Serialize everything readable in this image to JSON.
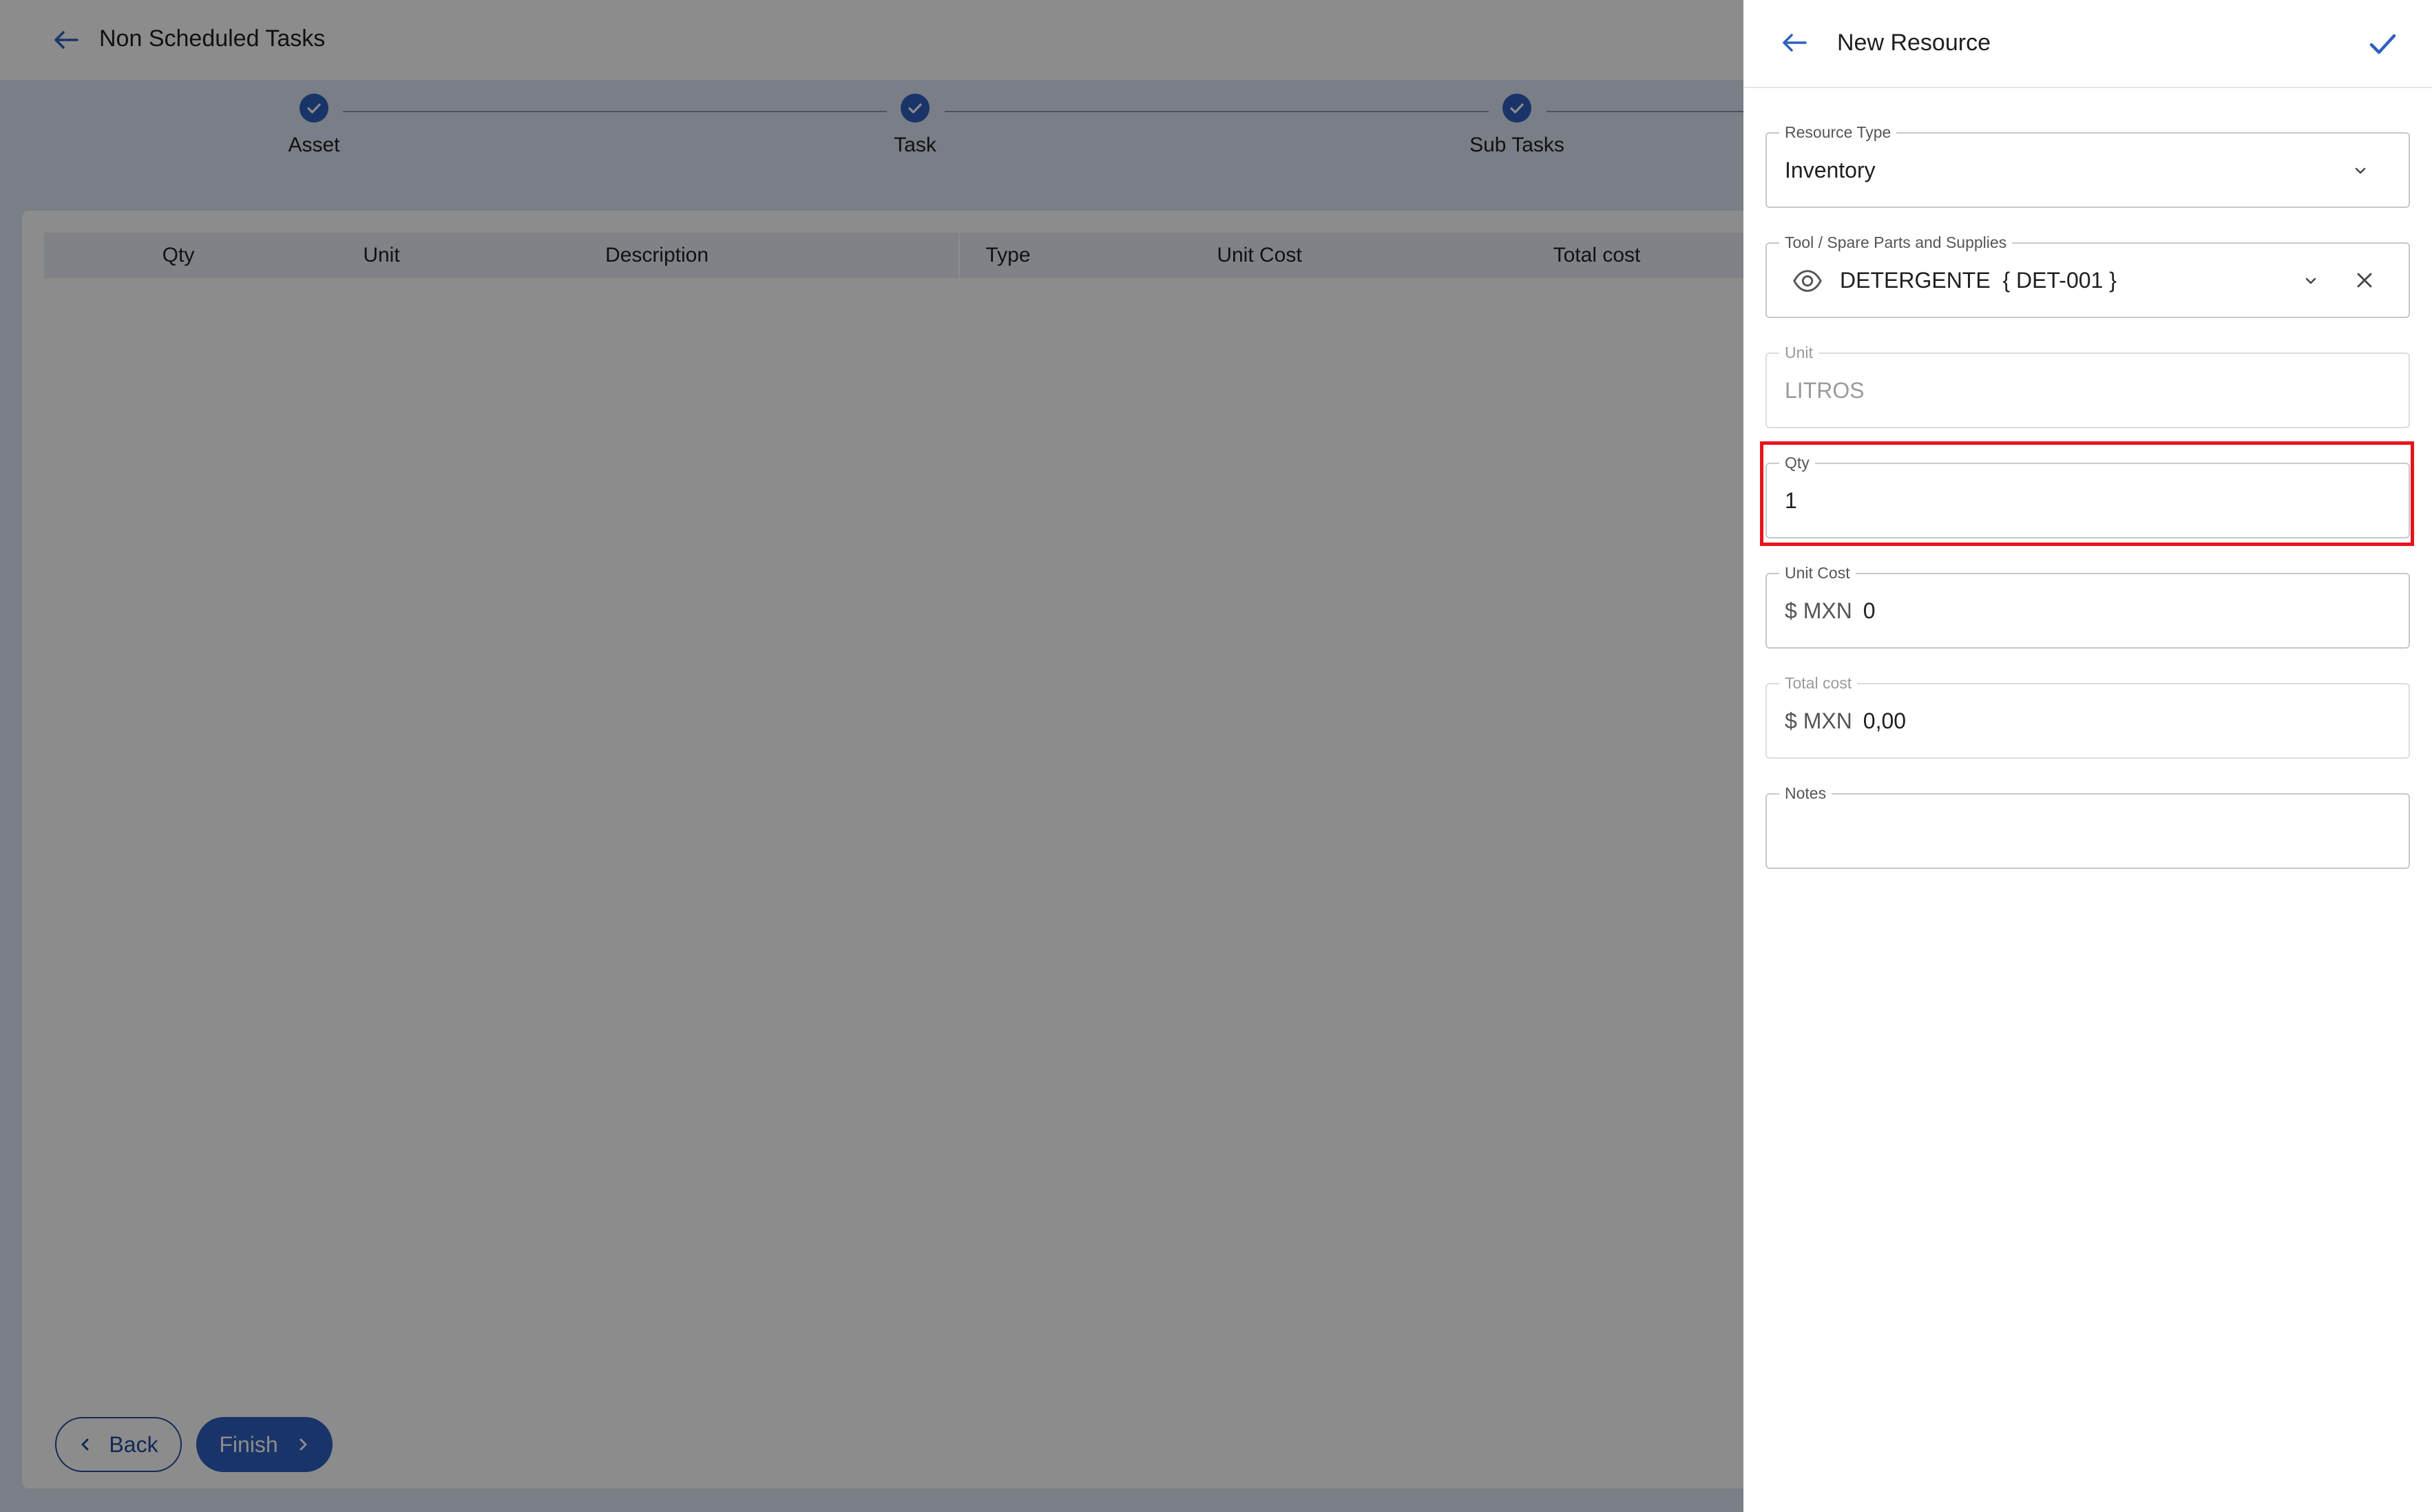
{
  "header": {
    "title": "Non Scheduled Tasks"
  },
  "stepper": {
    "steps": [
      {
        "label": "Asset"
      },
      {
        "label": "Task"
      },
      {
        "label": "Sub Tasks"
      }
    ]
  },
  "table": {
    "columns": [
      "Qty",
      "Unit",
      "Description",
      "Type",
      "Unit Cost",
      "Total cost"
    ]
  },
  "footer": {
    "back_label": "Back",
    "finish_label": "Finish"
  },
  "panel": {
    "title": "New Resource",
    "fields": {
      "resource_type": {
        "label": "Resource Type",
        "value": "Inventory"
      },
      "tool": {
        "label": "Tool / Spare Parts and Supplies",
        "value": "DETERGENTE  { DET-001 }"
      },
      "unit": {
        "label": "Unit",
        "value": "LITROS"
      },
      "qty": {
        "label": "Qty",
        "value": "1"
      },
      "unit_cost": {
        "label": "Unit Cost",
        "currency": "$ MXN",
        "value": "0"
      },
      "total_cost": {
        "label": "Total cost",
        "currency": "$ MXN",
        "value": "0,00"
      },
      "notes": {
        "label": "Notes",
        "value": ""
      }
    }
  },
  "colors": {
    "accent": "#2f5fbf",
    "highlight": "#e8141c"
  },
  "icons": {
    "back": "arrow-left-icon",
    "confirm": "check-icon",
    "step": "check-circle-icon",
    "dropdown": "chevron-down-icon",
    "view": "eye-icon",
    "clear": "close-icon"
  }
}
